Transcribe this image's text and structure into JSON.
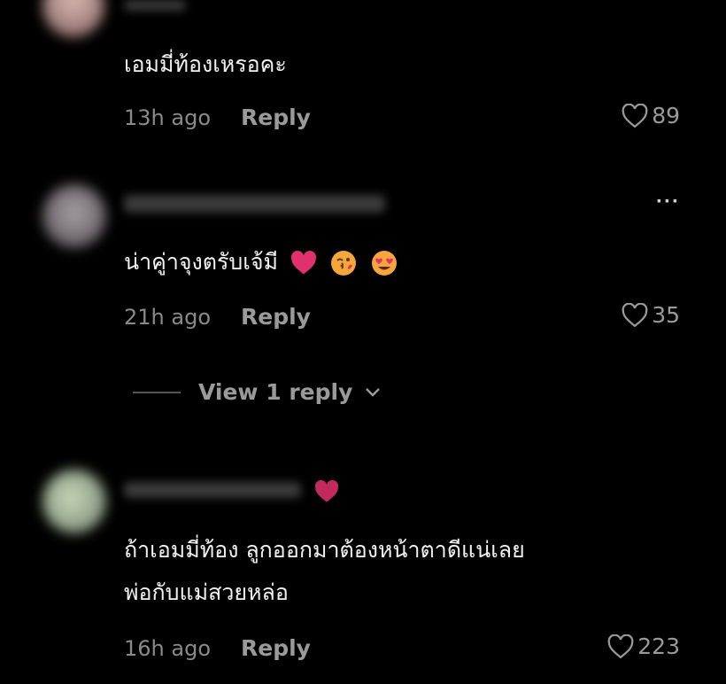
{
  "comments": [
    {
      "text": "เอมมี่ท้องเหรอคะ",
      "time": "13h ago",
      "reply_label": "Reply",
      "likes": "89"
    },
    {
      "text": "น่าคู่าจุงตรับเจ้มี",
      "time": "21h ago",
      "reply_label": "Reply",
      "likes": "35",
      "more_label": "···",
      "emojis": [
        "pink-heart-icon",
        "kissing-face-icon",
        "heart-eyes-face-icon"
      ]
    },
    {
      "text_line1": "ถ้าเอมมี่ท้อง ลูกออกมาต้องหน้าตาดีแน่เลย",
      "text_line2": "พ่อกับแม่สวยหล่อ",
      "time": "16h ago",
      "reply_label": "Reply",
      "likes": "223",
      "username_emoji": "pink-heart-icon"
    }
  ],
  "view_replies": {
    "label": "View 1 reply",
    "icon": "chevron-down-icon"
  },
  "colors": {
    "background": "#000000",
    "text": "#f2f2f2",
    "muted": "#8a8a8a",
    "heart": "#e0306e"
  }
}
